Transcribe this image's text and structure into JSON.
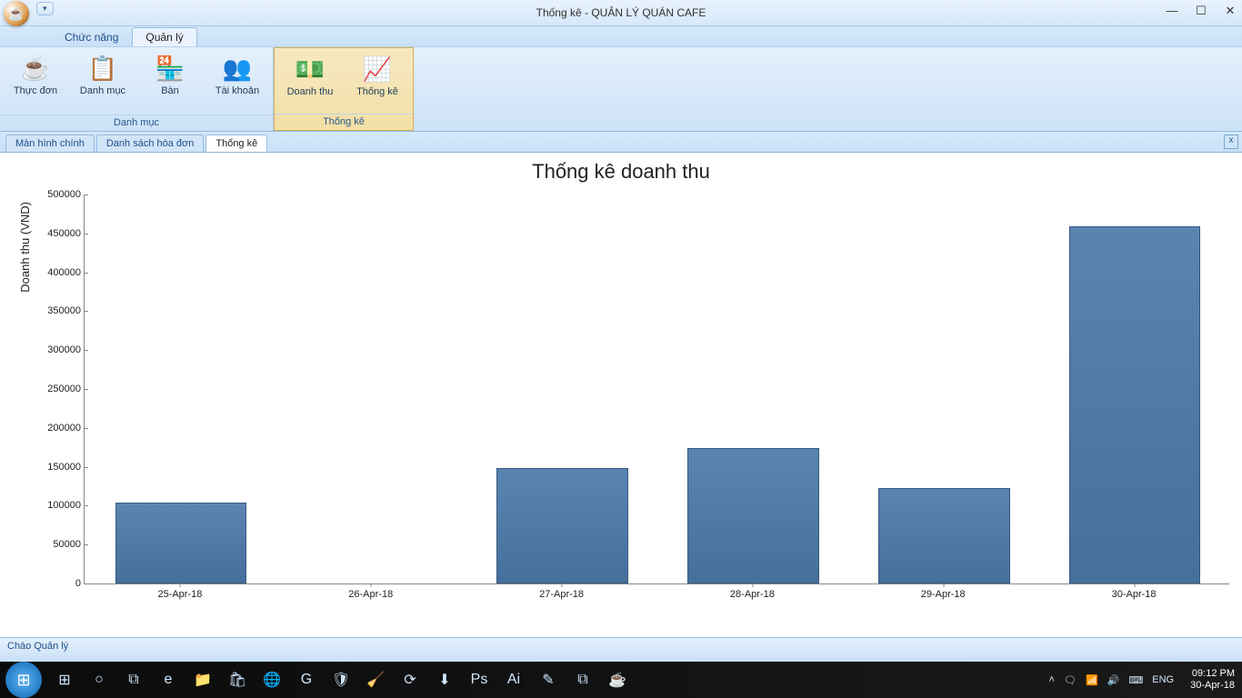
{
  "window": {
    "title": "Thống kê - QUẢN LÝ QUÁN CAFE",
    "qat": "▾"
  },
  "menu": {
    "tabs": [
      "Chức năng",
      "Quản lý"
    ],
    "active": 1
  },
  "ribbon": {
    "groups": [
      {
        "title": "Danh mục",
        "items": [
          {
            "icon": "☕",
            "label": "Thực đơn"
          },
          {
            "icon": "📋",
            "label": "Danh mục"
          },
          {
            "icon": "🏪",
            "label": "Bàn"
          },
          {
            "icon": "👥",
            "label": "Tài khoản"
          }
        ]
      },
      {
        "title": "Thống kê",
        "selected": true,
        "items": [
          {
            "icon": "💵",
            "label": "Doanh thu"
          },
          {
            "icon": "📈",
            "label": "Thống kê"
          }
        ]
      }
    ]
  },
  "doc_tabs": {
    "items": [
      "Màn hình chính",
      "Danh sách hóa đơn",
      "Thống kê"
    ],
    "active": 2
  },
  "status": "Chào Quản lý",
  "chart_data": {
    "type": "bar",
    "title": "Thống kê doanh thu",
    "ylabel": "Doanh thu (VND)",
    "xlabel": "",
    "categories": [
      "25-Apr-18",
      "26-Apr-18",
      "27-Apr-18",
      "28-Apr-18",
      "29-Apr-18",
      "30-Apr-18"
    ],
    "values": [
      102000,
      0,
      146000,
      172000,
      120000,
      457000
    ],
    "ylim": [
      0,
      500000
    ],
    "ytick_step": 50000
  },
  "taskbar": {
    "icons": [
      "⊞",
      "○",
      "⧉",
      "e",
      "📁",
      "🛍",
      "🌐",
      "G",
      "🛡",
      "🧹",
      "⟳",
      "⬇",
      "Ps",
      "Ai",
      "✎",
      "⧉",
      "☕"
    ],
    "tray": [
      "˄",
      "🗨",
      "📶",
      "🔊",
      "⌨",
      "ENG"
    ],
    "clock": {
      "time": "09:12 PM",
      "date": "30-Apr-18"
    }
  }
}
